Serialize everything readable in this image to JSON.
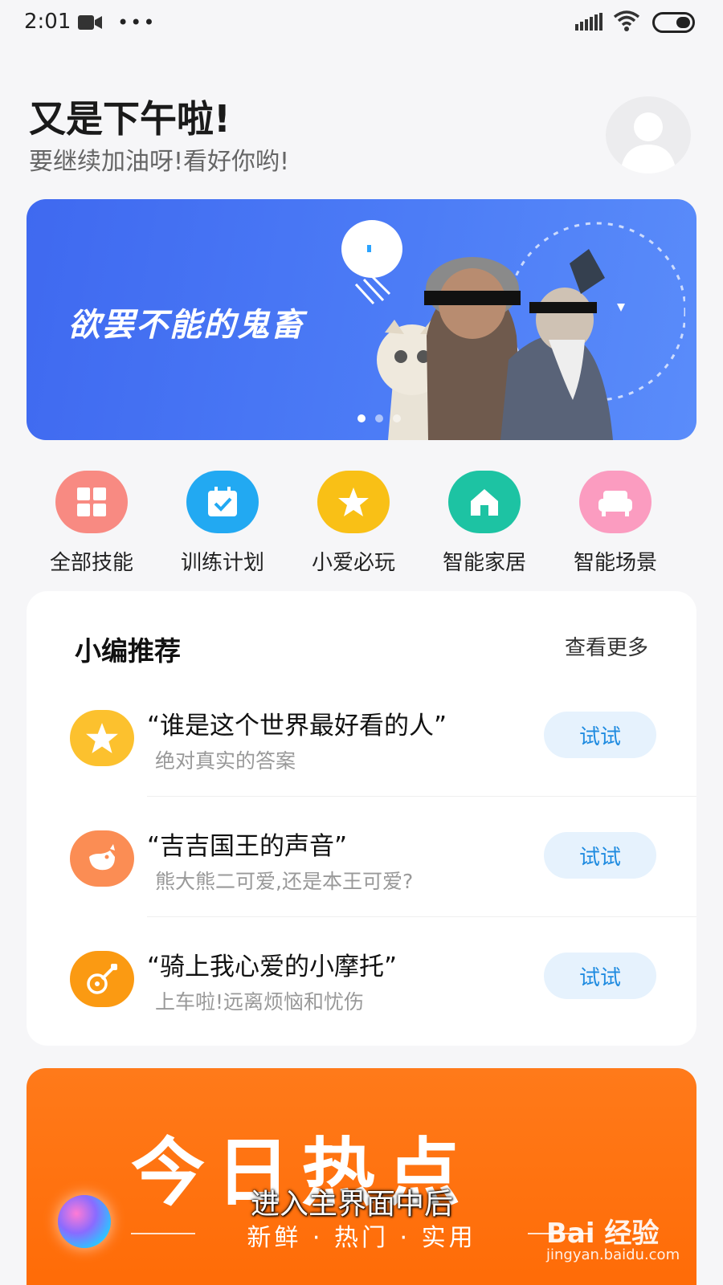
{
  "status_bar": {
    "time": "2:01",
    "icons": [
      "video-icon",
      "more-icon",
      "signal-icon",
      "wifi-icon",
      "battery-icon"
    ],
    "more_glyph": "•••"
  },
  "greeting": {
    "title": "又是下午啦!",
    "subtitle": "要继续加油呀!看好你哟!"
  },
  "banner": {
    "text": "欲罢不能的鬼畜",
    "dots": 3,
    "active_dot": 0,
    "color": "#4574f3"
  },
  "quick_entries": [
    {
      "label": "全部技能",
      "icon": "grid-icon",
      "color": "#f88a82"
    },
    {
      "label": "训练计划",
      "icon": "calendar-check-icon",
      "color": "#22a9f2"
    },
    {
      "label": "小爱必玩",
      "icon": "star-icon",
      "color": "#f9c016"
    },
    {
      "label": "智能家居",
      "icon": "home-icon",
      "color": "#1dc3a3"
    },
    {
      "label": "智能场景",
      "icon": "sofa-icon",
      "color": "#fb9cc0"
    }
  ],
  "recommend": {
    "title": "小编推荐",
    "more": "查看更多",
    "items": [
      {
        "main": "“谁是这个世界最好看的人”",
        "desc": "绝对真实的答案",
        "button": "试试",
        "icon": "star-icon",
        "color": "#fcc12e"
      },
      {
        "main": "“吉吉国王的声音”",
        "desc": "熊大熊二可爱,还是本王可爱?",
        "button": "试试",
        "icon": "bird-icon",
        "color": "#fb8d54"
      },
      {
        "main": "“骑上我心爱的小摩托”",
        "desc": "上车啦!远离烦恼和忧伤",
        "button": "试试",
        "icon": "guitar-icon",
        "color": "#fb9a12"
      }
    ]
  },
  "hot": {
    "title": "今日热点",
    "subtitle": "新鲜 · 热门 · 实用",
    "color": "#ff7011"
  },
  "overlay": {
    "caption": "进入主界面中后",
    "watermark": "Bai 经验",
    "watermark_url": "jingyan.baidu.com"
  }
}
